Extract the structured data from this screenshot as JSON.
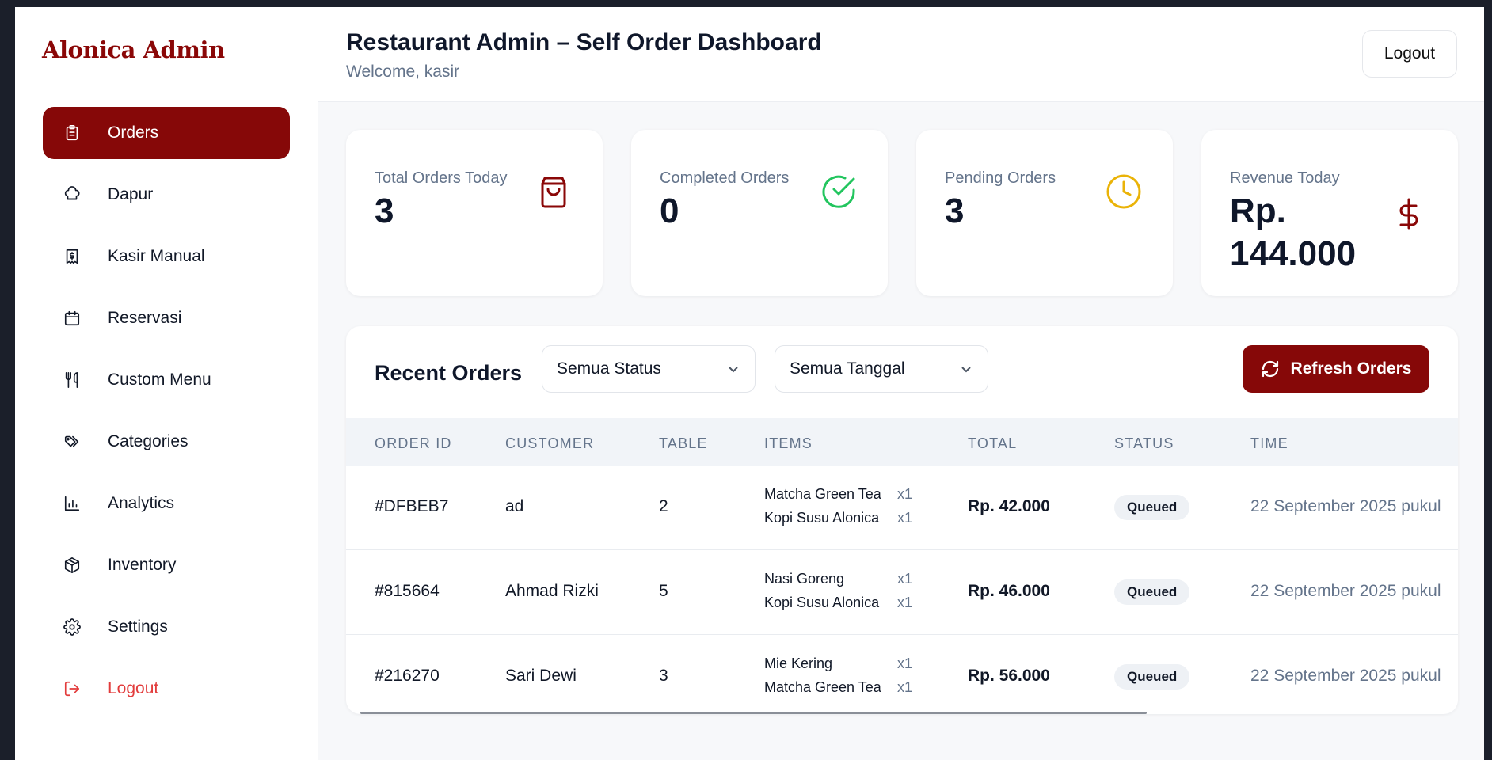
{
  "brand": "Alonica Admin",
  "sidebar": {
    "items": [
      {
        "label": "Orders",
        "icon": "clipboard-icon",
        "active": true
      },
      {
        "label": "Dapur",
        "icon": "chef-hat-icon"
      },
      {
        "label": "Kasir Manual",
        "icon": "receipt-icon"
      },
      {
        "label": "Reservasi",
        "icon": "calendar-icon"
      },
      {
        "label": "Custom Menu",
        "icon": "utensils-icon"
      },
      {
        "label": "Categories",
        "icon": "tags-icon"
      },
      {
        "label": "Analytics",
        "icon": "bar-chart-icon"
      },
      {
        "label": "Inventory",
        "icon": "package-icon"
      },
      {
        "label": "Settings",
        "icon": "gear-icon"
      },
      {
        "label": "Logout",
        "icon": "logout-icon"
      }
    ]
  },
  "header": {
    "title": "Restaurant Admin – Self Order Dashboard",
    "welcome": "Welcome, kasir",
    "logout_label": "Logout"
  },
  "stats": [
    {
      "label": "Total Orders Today",
      "value": "3",
      "icon": "shopping-bag-icon",
      "color": "#8a0707"
    },
    {
      "label": "Completed Orders",
      "value": "0",
      "icon": "check-circle-icon",
      "color": "#22c55e"
    },
    {
      "label": "Pending Orders",
      "value": "3",
      "icon": "clock-icon",
      "color": "#eab308"
    },
    {
      "label": "Revenue Today",
      "value": "Rp. 144.000",
      "icon": "dollar-icon",
      "color": "#8a0707"
    }
  ],
  "orders": {
    "title": "Recent Orders",
    "status_filter": "Semua Status",
    "date_filter": "Semua Tanggal",
    "refresh_label": "Refresh Orders",
    "columns": [
      "Order ID",
      "Customer",
      "Table",
      "Items",
      "Total",
      "Status",
      "Time"
    ],
    "rows": [
      {
        "id": "#DFBEB7",
        "customer": "ad",
        "table": "2",
        "items": [
          {
            "name": "Matcha Green Tea",
            "qty": "x1"
          },
          {
            "name": "Kopi Susu Alonica",
            "qty": "x1"
          }
        ],
        "total": "Rp. 42.000",
        "status": "Queued",
        "time": "22 September 2025 pukul"
      },
      {
        "id": "#815664",
        "customer": "Ahmad Rizki",
        "table": "5",
        "items": [
          {
            "name": "Nasi Goreng",
            "qty": "x1"
          },
          {
            "name": "Kopi Susu Alonica",
            "qty": "x1"
          }
        ],
        "total": "Rp. 46.000",
        "status": "Queued",
        "time": "22 September 2025 pukul"
      },
      {
        "id": "#216270",
        "customer": "Sari Dewi",
        "table": "3",
        "items": [
          {
            "name": "Mie Kering",
            "qty": "x1"
          },
          {
            "name": "Matcha Green Tea",
            "qty": "x1"
          }
        ],
        "total": "Rp. 56.000",
        "status": "Queued",
        "time": "22 September 2025 pukul"
      }
    ]
  },
  "colors": {
    "accent": "#860808",
    "muted": "#64748b",
    "danger": "#e23b3b"
  }
}
